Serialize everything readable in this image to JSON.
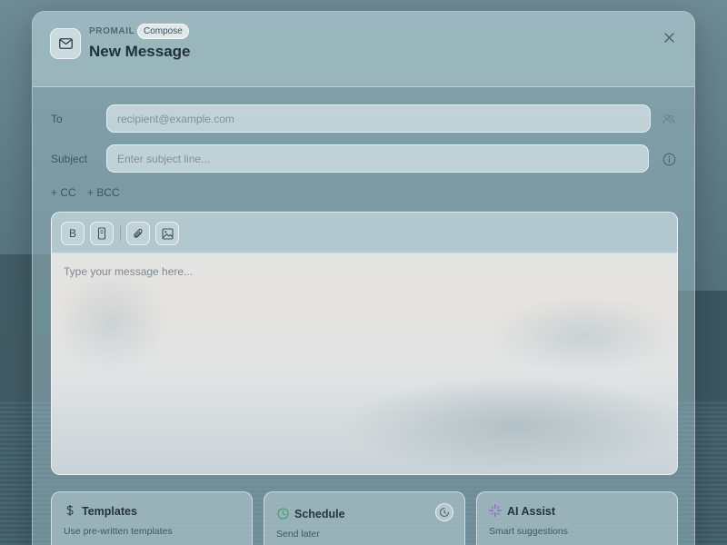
{
  "header": {
    "brand": "PROMAIL",
    "mode_badge": "Compose",
    "title": "New Message",
    "icon": "mail-icon",
    "close_icon": "close-icon"
  },
  "fields": {
    "to": {
      "label": "To",
      "placeholder": "recipient@example.com",
      "value": "",
      "side_icon": "contacts-icon"
    },
    "subject": {
      "label": "Subject",
      "placeholder": "Enter subject line...",
      "value": "",
      "side_icon": "info-icon"
    }
  },
  "links": {
    "cc": "+ CC",
    "bcc": "+ BCC"
  },
  "toolbar": {
    "bold_label": "B",
    "items": [
      "bold",
      "code-block",
      "attachment",
      "image"
    ]
  },
  "editor": {
    "placeholder": "Type your message here...",
    "value": ""
  },
  "cards": [
    {
      "title": "Templates",
      "subtitle": "Use pre-written templates",
      "icon": "dollar-icon"
    },
    {
      "title": "Schedule",
      "subtitle": "Send later",
      "icon": "clock-icon",
      "extra_icon": "timer-icon"
    },
    {
      "title": "AI Assist",
      "subtitle": "Smart suggestions",
      "icon": "sparkle-icon"
    }
  ],
  "colors": {
    "schedule_accent": "#3fa46a",
    "ai_accent": "#8a5cc7"
  }
}
